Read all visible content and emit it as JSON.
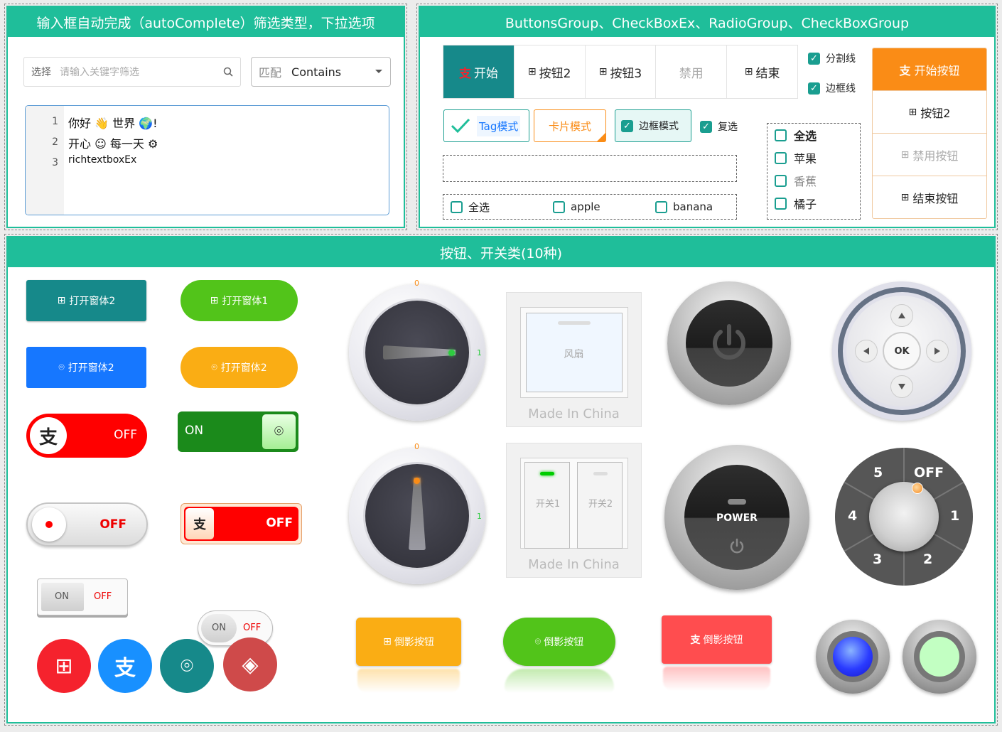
{
  "panels": {
    "autocomplete": {
      "title": "输入框自动完成（autoComplete）筛选类型，下拉选项",
      "search_prefix": "选择",
      "search_placeholder": "请输入关键字筛选",
      "match_prefix": "匹配",
      "match_value": "Contains",
      "editor_lines": [
        {
          "num": "1",
          "text": "你好 👋 世界 🌍!"
        },
        {
          "num": "2",
          "text": "开心 ☺ 每一天 ⚙"
        },
        {
          "num": "3",
          "text": "richtextboxEx"
        }
      ]
    },
    "groups": {
      "title": "ButtonsGroup、CheckBoxEx、RadioGroup、CheckBoxGroup",
      "segments": [
        "开始",
        "按钮2",
        "按钮3",
        "禁用",
        "结束"
      ],
      "options": [
        {
          "label": "分割线",
          "checked": true
        },
        {
          "label": "边框线",
          "checked": true
        }
      ],
      "tag_mode": "Tag模式",
      "card_mode": "卡片模式",
      "border_mode": "边框模式",
      "multi_select": "复选",
      "check_row": [
        "全选",
        "apple",
        "banana"
      ],
      "check_col": [
        "全选",
        "苹果",
        "香蕉",
        "橘子"
      ],
      "vbuttons": [
        "开始按钮",
        "按钮2",
        "禁用按钮",
        "结束按钮"
      ]
    },
    "buttons": {
      "title": "按钮、开关类(10种)",
      "btn_open2_win": "打开窗体2",
      "btn_open1": "打开窗体1",
      "btn_open2_apple": "打开窗体2",
      "btn_open2_orange": "打开窗体2",
      "toggle_off": "OFF",
      "toggle_on": "ON",
      "toggle_off2": "OFF",
      "toggle_off3": "OFF",
      "mini_on": "ON",
      "mini_off": "OFF",
      "mini2_on": "ON",
      "mini2_off": "OFF",
      "knob_zero": "0",
      "knob_one": "1",
      "knob2_zero": "0",
      "knob2_one": "1",
      "fan_label": "风扇",
      "made_in": "Made In China",
      "made_in2": "Made In China",
      "switch1": "开关1",
      "switch2": "开关2",
      "power_label": "POWER",
      "dpad_ok": "OK",
      "rotary": [
        "5",
        "OFF",
        "4",
        "1",
        "3",
        "2"
      ],
      "refl_buttons": [
        "倒影按钮",
        "倒影按钮",
        "倒影按钮"
      ]
    }
  },
  "colors": {
    "accent": "#1fbe9a",
    "teal": "#16898a",
    "green": "#52c41a",
    "blue": "#1677ff",
    "orange": "#faad14",
    "red": "#f5222d",
    "darkorange": "#fa8c16"
  }
}
